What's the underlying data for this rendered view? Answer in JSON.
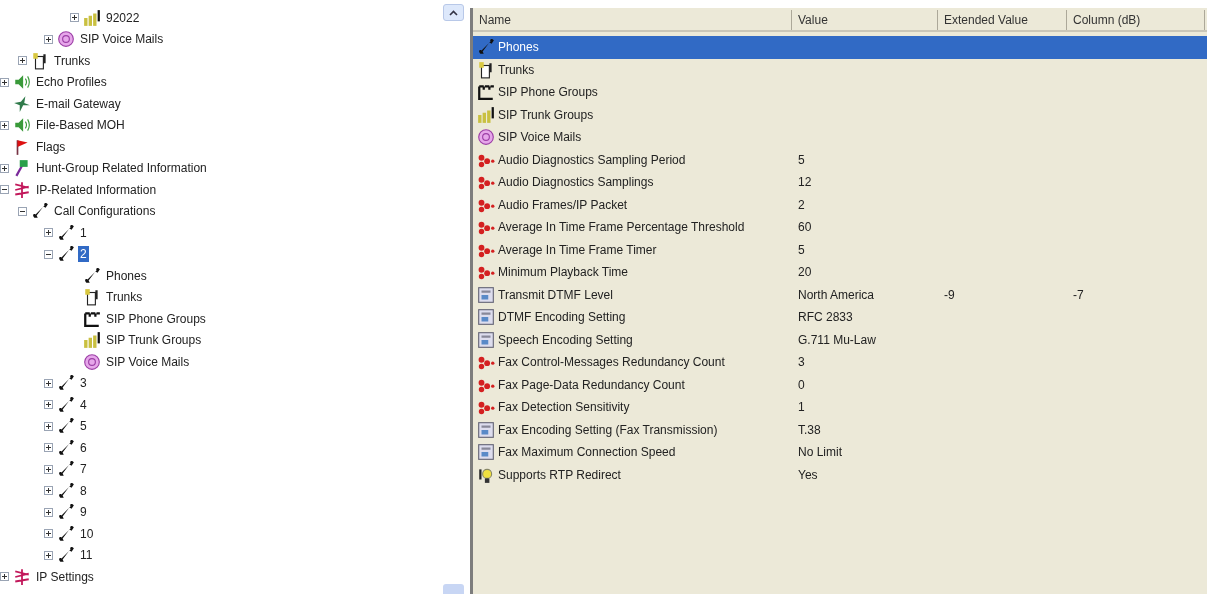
{
  "tree": {
    "items": [
      {
        "children": [
          {
            "children": [
              {
                "children": [
                  {
                    "label": "92022",
                    "kind": "trunkgroups",
                    "expanded": false,
                    "selected": false
                  }
                ]
              },
              {
                "label": "SIP Voice Mails",
                "kind": "voicemail",
                "expanded": false,
                "selected": false
              }
            ]
          },
          {
            "label": "Trunks",
            "kind": "trunk",
            "expanded": false,
            "selected": false
          }
        ]
      },
      {
        "label": "Echo Profiles",
        "kind": "speaker",
        "expanded": false,
        "selected": false
      },
      {
        "label": "E-mail Gateway",
        "kind": "gateway",
        "selected": false
      },
      {
        "label": "File-Based MOH",
        "kind": "speaker",
        "expanded": false,
        "selected": false
      },
      {
        "label": "Flags",
        "kind": "flag",
        "selected": false
      },
      {
        "label": "Hunt-Group Related Information",
        "kind": "hunt",
        "expanded": false,
        "selected": false
      },
      {
        "label": "IP-Related Information",
        "kind": "ip",
        "expanded": true,
        "selected": false,
        "children": [
          {
            "label": "Call Configurations",
            "kind": "phone",
            "expanded": true,
            "selected": false,
            "children": [
              {
                "label": "1",
                "kind": "phone",
                "expanded": false,
                "selected": false
              },
              {
                "label": "2",
                "kind": "phone",
                "expanded": true,
                "selected": true,
                "children": [
                  {
                    "label": "Phones",
                    "kind": "phone",
                    "selected": false
                  },
                  {
                    "label": "Trunks",
                    "kind": "trunk",
                    "selected": false
                  },
                  {
                    "label": "SIP Phone Groups",
                    "kind": "phonegroups",
                    "selected": false
                  },
                  {
                    "label": "SIP Trunk Groups",
                    "kind": "trunkgroups",
                    "selected": false
                  },
                  {
                    "label": "SIP Voice Mails",
                    "kind": "voicemail",
                    "selected": false
                  }
                ]
              },
              {
                "label": "3",
                "kind": "phone",
                "expanded": false,
                "selected": false
              },
              {
                "label": "4",
                "kind": "phone",
                "expanded": false,
                "selected": false
              },
              {
                "label": "5",
                "kind": "phone",
                "expanded": false,
                "selected": false
              },
              {
                "label": "6",
                "kind": "phone",
                "expanded": false,
                "selected": false
              },
              {
                "label": "7",
                "kind": "phone",
                "expanded": false,
                "selected": false
              },
              {
                "label": "8",
                "kind": "phone",
                "expanded": false,
                "selected": false
              },
              {
                "label": "9",
                "kind": "phone",
                "expanded": false,
                "selected": false
              },
              {
                "label": "10",
                "kind": "phone",
                "expanded": false,
                "selected": false
              },
              {
                "label": "11",
                "kind": "phone",
                "expanded": false,
                "selected": false
              }
            ]
          }
        ]
      },
      {
        "label": "IP Settings",
        "kind": "ip",
        "expanded": false,
        "selected": false
      }
    ]
  },
  "table": {
    "columns": [
      "Name",
      "Value",
      "Extended Value",
      "Column (dB)"
    ],
    "rows": [
      {
        "kind": "phone",
        "name": "Phones",
        "selected": true
      },
      {
        "kind": "trunk",
        "name": "Trunks",
        "selected": false
      },
      {
        "kind": "phonegroups",
        "name": "SIP Phone Groups",
        "selected": false
      },
      {
        "kind": "trunkgroups",
        "name": "SIP Trunk Groups",
        "selected": false
      },
      {
        "kind": "voicemail",
        "name": "SIP Voice Mails",
        "selected": false
      },
      {
        "kind": "param",
        "name": "Audio Diagnostics Sampling Period",
        "value": "5",
        "selected": false
      },
      {
        "kind": "param",
        "name": "Audio Diagnostics Samplings",
        "value": "12",
        "selected": false
      },
      {
        "kind": "param",
        "name": "Audio Frames/IP Packet",
        "value": "2",
        "selected": false
      },
      {
        "kind": "param",
        "name": "Average In Time Frame Percentage Threshold",
        "value": "60",
        "selected": false
      },
      {
        "kind": "param",
        "name": "Average In Time Frame Timer",
        "value": "5",
        "selected": false
      },
      {
        "kind": "param",
        "name": "Minimum Playback Time",
        "value": "20",
        "selected": false
      },
      {
        "kind": "setting",
        "name": "Transmit DTMF Level",
        "value": "North America",
        "extended": "-9",
        "column_db": "-7",
        "selected": false
      },
      {
        "kind": "setting",
        "name": "DTMF Encoding Setting",
        "value": "RFC 2833",
        "selected": false
      },
      {
        "kind": "setting",
        "name": "Speech Encoding Setting",
        "value": "G.711 Mu-Law",
        "selected": false
      },
      {
        "kind": "param",
        "name": "Fax Control-Messages Redundancy Count",
        "value": "3",
        "selected": false
      },
      {
        "kind": "param",
        "name": "Fax Page-Data Redundancy Count",
        "value": "0",
        "selected": false
      },
      {
        "kind": "param",
        "name": "Fax Detection Sensitivity",
        "value": "1",
        "selected": false
      },
      {
        "kind": "setting",
        "name": "Fax Encoding Setting (Fax Transmission)",
        "value": "T.38",
        "selected": false
      },
      {
        "kind": "setting",
        "name": "Fax Maximum Connection Speed",
        "value": "No Limit",
        "selected": false
      },
      {
        "kind": "bulb",
        "name": "Supports RTP Redirect",
        "value": "Yes",
        "selected": false
      }
    ]
  }
}
